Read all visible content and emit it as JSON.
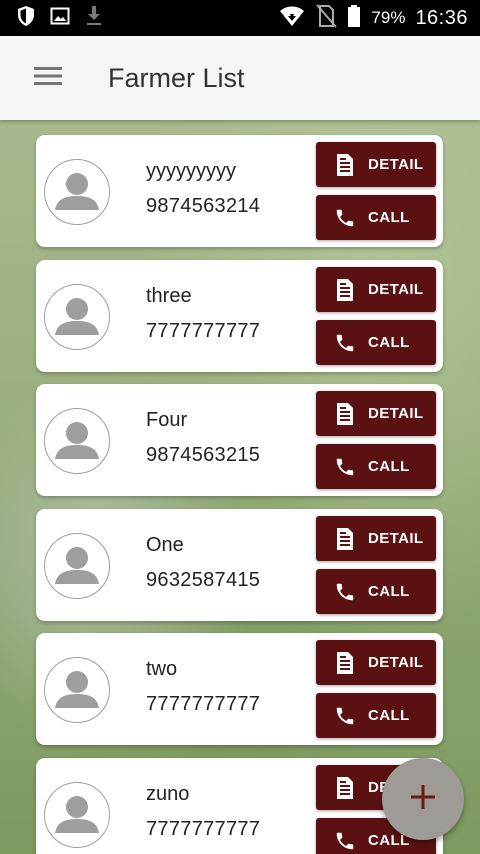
{
  "status_bar": {
    "battery_percent": "79%",
    "time": "16:36",
    "icons": [
      "shield-icon",
      "image-icon",
      "download-icon",
      "wifi-icon",
      "no-sim-icon",
      "battery-icon"
    ]
  },
  "app_bar": {
    "title": "Farmer List",
    "menu_icon": "hamburger-menu-icon"
  },
  "farmers": [
    {
      "name": "yyyyyyyyy",
      "phone": "9874563214",
      "detail_label": "DETAIL",
      "call_label": "CALL"
    },
    {
      "name": "three",
      "phone": "7777777777",
      "detail_label": "DETAIL",
      "call_label": "CALL"
    },
    {
      "name": "Four",
      "phone": "9874563215",
      "detail_label": "DETAIL",
      "call_label": "CALL"
    },
    {
      "name": "One",
      "phone": "9632587415",
      "detail_label": "DETAIL",
      "call_label": "CALL"
    },
    {
      "name": "two",
      "phone": "7777777777",
      "detail_label": "DETAIL",
      "call_label": "CALL"
    },
    {
      "name": "zuno",
      "phone": "7777777777",
      "detail_label": "DETAIL",
      "call_label": "CALL"
    }
  ],
  "fab": {
    "icon": "plus-icon"
  },
  "colors": {
    "button": "#5b1111",
    "fab": "#9e9b97",
    "fab_icon": "#6b1a1a",
    "app_bar": "#f5f5f5"
  }
}
